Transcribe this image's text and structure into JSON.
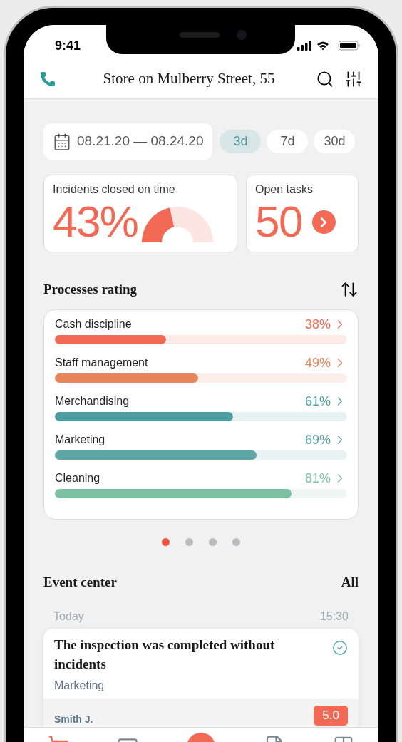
{
  "status_bar": {
    "time": "9:41"
  },
  "header": {
    "title": "Store on Mulberry Street, 55"
  },
  "date_range": {
    "label": "08.21.20 — 08.24.20"
  },
  "periods": [
    {
      "label": "3d",
      "selected": true
    },
    {
      "label": "7d",
      "selected": false
    },
    {
      "label": "30d",
      "selected": false
    }
  ],
  "kpis": [
    {
      "kind": "gauge",
      "title": "Incidents closed on time",
      "value": "43%",
      "level": 0.43
    },
    {
      "kind": "count",
      "title": "Open tasks",
      "value": "50"
    }
  ],
  "processes": {
    "title": "Processes rating",
    "items": [
      {
        "name": "Cash discipline",
        "reading": "38%",
        "level": 0.38,
        "color": "#f26a55"
      },
      {
        "name": "Staff management",
        "reading": "49%",
        "level": 0.49,
        "color": "#e8855a"
      },
      {
        "name": "Merchandising",
        "reading": "61%",
        "level": 0.61,
        "color": "#4e9ea2"
      },
      {
        "name": "Marketing",
        "reading": "69%",
        "level": 0.69,
        "color": "#5ea6a8"
      },
      {
        "name": "Cleaning",
        "reading": "81%",
        "level": 0.81,
        "color": "#7cc0a4"
      }
    ]
  },
  "pager": [
    {
      "selected": true
    },
    {
      "selected": false
    },
    {
      "selected": false
    },
    {
      "selected": false
    }
  ],
  "events": {
    "title": "Event center",
    "link": "All",
    "groups": [
      {
        "date": "Today",
        "items": [
          {
            "time": "15:30",
            "title": "The inspection was completed without incidents",
            "category": "Marketing",
            "checked": true,
            "author": "Smith J.",
            "score": "5.0"
          }
        ]
      }
    ]
  },
  "tab_bar": [
    {
      "kind": "cart",
      "selected": true
    },
    {
      "kind": "card",
      "selected": false
    },
    {
      "kind": "add",
      "selected": false
    },
    {
      "kind": "document",
      "selected": false
    },
    {
      "kind": "grid",
      "selected": false
    }
  ]
}
